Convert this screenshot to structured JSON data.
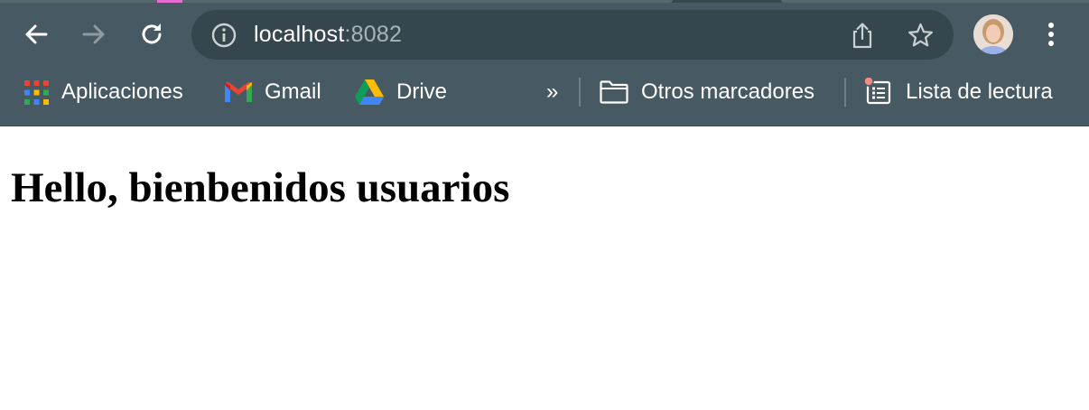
{
  "browser": {
    "url_host": "localhost",
    "url_port": ":8082",
    "icons": {
      "back": "arrow-left-icon",
      "forward": "arrow-right-icon",
      "reload": "reload-icon",
      "site_info": "info-icon",
      "share": "share-icon",
      "bookmark": "star-icon",
      "menu": "kebab-menu-icon"
    },
    "colors": {
      "toolbar": "#475a64",
      "omnibox": "#36464f",
      "active_tab_hint": "#e66bd2",
      "reading_list_badge": "#f28b82"
    }
  },
  "bookmarks": {
    "apps_label": "Aplicaciones",
    "gmail_label": "Gmail",
    "drive_label": "Drive",
    "overflow_label": "»",
    "other_label": "Otros marcadores",
    "reading_list_label": "Lista de lectura"
  },
  "page": {
    "heading": "Hello, bienbenidos usuarios"
  }
}
